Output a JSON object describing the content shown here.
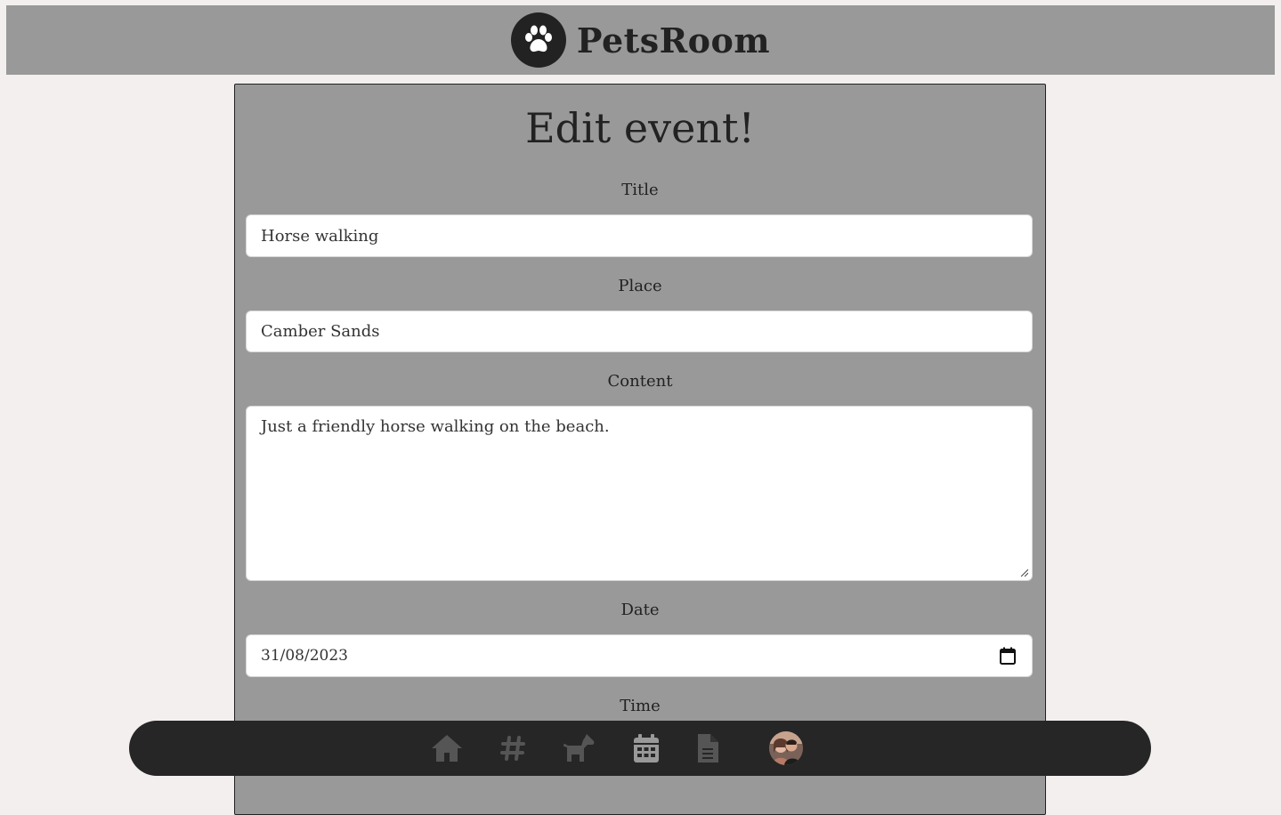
{
  "header": {
    "brand": "PetsRoom",
    "logo_icon": "paw-icon"
  },
  "form": {
    "heading": "Edit event!",
    "title_label": "Title",
    "title_value": "Horse walking",
    "place_label": "Place",
    "place_value": "Camber Sands",
    "content_label": "Content",
    "content_value": "Just a friendly horse walking on the beach.",
    "date_label": "Date",
    "date_value": "31/08/2023",
    "time_label": "Time"
  },
  "nav": {
    "items": [
      {
        "name": "home",
        "icon": "home-icon"
      },
      {
        "name": "feed",
        "icon": "hashtag-icon"
      },
      {
        "name": "pets",
        "icon": "dog-icon"
      },
      {
        "name": "events",
        "icon": "calendar-icon",
        "active": true
      },
      {
        "name": "posts",
        "icon": "document-icon"
      },
      {
        "name": "profile",
        "icon": "avatar"
      }
    ]
  },
  "colors": {
    "page_bg": "#f2efee",
    "panel_bg": "#999999",
    "dark": "#262626",
    "nav_icon": "#555555",
    "nav_icon_active": "#999999"
  }
}
